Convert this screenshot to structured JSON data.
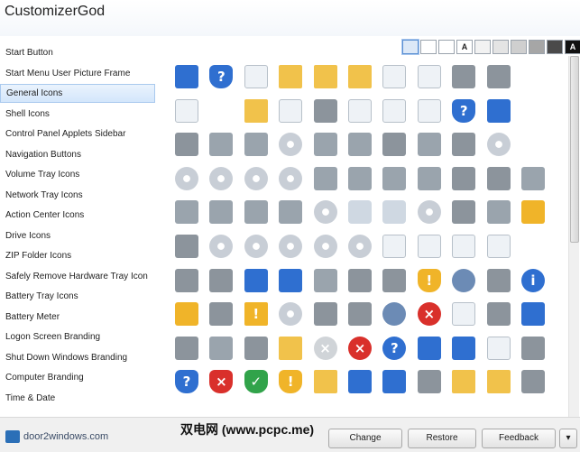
{
  "window": {
    "title": "CustomizerGod"
  },
  "sidebar": {
    "items": [
      {
        "label": "Start Button"
      },
      {
        "label": "Start Menu User Picture Frame"
      },
      {
        "label": "General Icons"
      },
      {
        "label": "Shell Icons"
      },
      {
        "label": "Control Panel Applets Sidebar"
      },
      {
        "label": "Navigation Buttons"
      },
      {
        "label": "Volume Tray Icons"
      },
      {
        "label": "Network Tray Icons"
      },
      {
        "label": "Action Center Icons"
      },
      {
        "label": "Drive Icons"
      },
      {
        "label": "ZIP Folder Icons"
      },
      {
        "label": "Safely Remove Hardware Tray Icon"
      },
      {
        "label": "Battery Tray Icons"
      },
      {
        "label": "Battery Meter"
      },
      {
        "label": "Logon Screen Branding"
      },
      {
        "label": "Shut Down Windows Branding"
      },
      {
        "label": "Computer Branding"
      },
      {
        "label": "Time & Date"
      }
    ],
    "selected_index": 2
  },
  "background_swatches": [
    {
      "color": "#dce8f7",
      "glyph": ""
    },
    {
      "color": "#ffffff",
      "glyph": ""
    },
    {
      "color": "#ffffff",
      "glyph": ""
    },
    {
      "color": "#ffffff",
      "glyph": "A"
    },
    {
      "color": "#f2f2f2",
      "glyph": ""
    },
    {
      "color": "#e4e4e4",
      "glyph": ""
    },
    {
      "color": "#cfcfcf",
      "glyph": ""
    },
    {
      "color": "#a6a6a6",
      "glyph": ""
    },
    {
      "color": "#4a4a4a",
      "glyph": ""
    },
    {
      "color": "#111111",
      "glyph": "A"
    },
    {
      "color": "#000000",
      "glyph": ""
    }
  ],
  "selected_swatch": 0,
  "icons": [
    [
      "monitor",
      "shield-flag",
      "blank-doc",
      "folder-yellow",
      "folder-yellow",
      "folder-narrow",
      "search-doc",
      "shortcut-doc",
      "narrow-shape",
      "puzzle-person"
    ],
    [
      "window-doc",
      "",
      "folder-search",
      "text-doc",
      "envelope",
      "image-doc",
      "media-doc",
      "film-doc",
      "globe-shield",
      "network-computer"
    ],
    [
      "control-panel",
      "floppy",
      "drive-removable",
      "cd-music",
      "drive-x",
      "drive",
      "chip",
      "drive-arrow",
      "windows-flag",
      "dvd"
    ],
    [
      "dvd-r",
      "dvd-ram",
      "dvd-rom",
      "dvd-rw",
      "floppy-blue",
      "drive-bay",
      "zip-drive",
      "network-drive",
      "camera",
      "phone",
      "floppy-check"
    ],
    [
      "drive-check",
      "drive-play",
      "drive-gray",
      "floppy-purple",
      "cd-purple",
      "recycle-empty",
      "recycle-full",
      "dvd-disc",
      "camera-gray",
      "usb",
      "lock"
    ],
    [
      "memory-card",
      "cd",
      "cd-r",
      "cd-rom",
      "cd-rw",
      "disc-icon",
      "help-doc",
      "settings-doc",
      "game-doc",
      "picture-doc"
    ],
    [
      "landscape",
      "photo",
      "network-user",
      "network-share",
      "network-drive-2",
      "printer",
      "font-a",
      "shield-warn",
      "users",
      "server",
      "info"
    ],
    [
      "key",
      "picture-frame",
      "warning",
      "cd-audio",
      "cycle-arrows",
      "binoculars",
      "users-pair",
      "red-x",
      "task-doc",
      "scanner",
      "screen-shot"
    ],
    [
      "pda",
      "usb-plug",
      "disk-gray",
      "folder-blue",
      "gray-x",
      "red-circle-x",
      "help-circle",
      "display",
      "monitor-blue",
      "text-page",
      "easel"
    ],
    [
      "shield-help",
      "shield-red",
      "shield-green",
      "shield-yellow",
      "folder-music",
      "network-pc",
      "screen",
      "color-tiles",
      "folder-doc",
      "folder-open",
      "checklist"
    ]
  ],
  "status": {
    "brand_text": "door2windows.com",
    "buttons": {
      "change": "Change",
      "restore": "Restore",
      "feedback": "Feedback",
      "menu": "▾"
    },
    "watermark": "双电网 (www.pcpc.me)"
  },
  "colors": {
    "accent": "#a9c9ee",
    "selected_bg": "#d3e6fb"
  }
}
